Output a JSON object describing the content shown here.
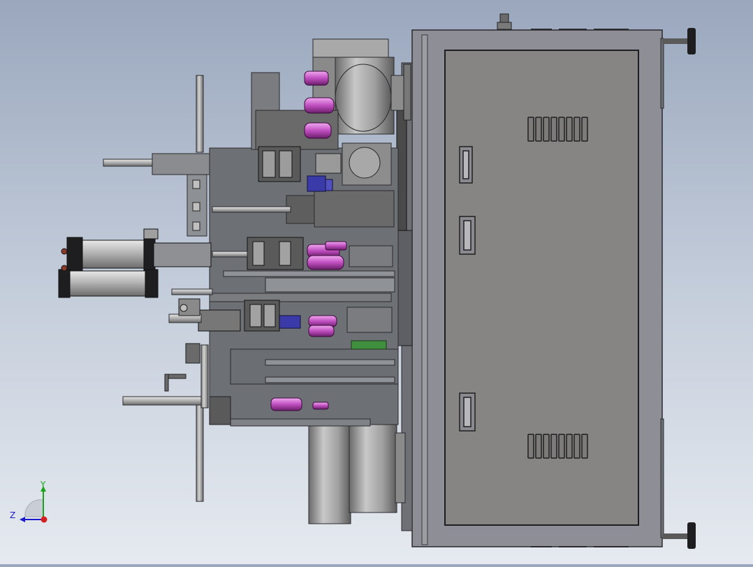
{
  "viewport": {
    "background_top": "#9aa7bd",
    "background_bottom": "#e6eaf0"
  },
  "model_colors": {
    "cabinet": "#8f8f95",
    "panel": "#888685",
    "frame": "#7c7e84",
    "dark": "#2a2a2e",
    "accent_pink": "#c04fc0",
    "accent_blue": "#3a3aa8",
    "accent_green": "#3f8f3f"
  },
  "axis_triad": {
    "y_label": "Y",
    "z_label": "Z",
    "y_color": "#1aa31a",
    "z_color": "#1a1acc",
    "x_color": "#d42020"
  }
}
